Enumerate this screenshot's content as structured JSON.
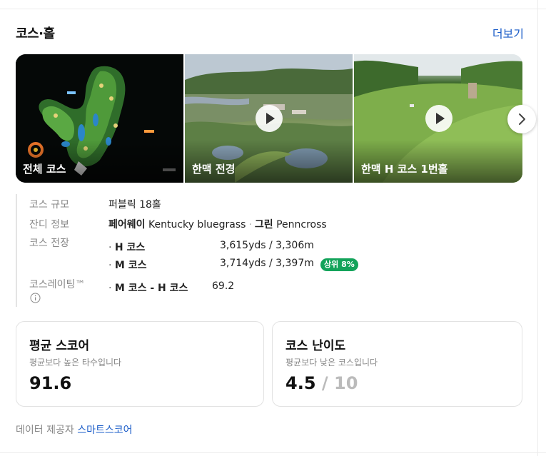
{
  "header": {
    "title": "코스·홀",
    "more_label": "더보기"
  },
  "gallery": [
    {
      "label": "전체 코스"
    },
    {
      "label": "한맥 전경"
    },
    {
      "label": "한맥 H 코스 1번홀"
    }
  ],
  "info": {
    "scale": {
      "label": "코스 규모",
      "value": "퍼블릭 18홀"
    },
    "turf": {
      "label": "잔디 정보",
      "fairway_name": "페어웨이",
      "fairway_value": "Kentucky bluegrass",
      "green_name": "그린",
      "green_value": "Penncross"
    },
    "length": {
      "label": "코스 전장",
      "rows": [
        {
          "name": "H 코스",
          "value": "3,615yds / 3,306m"
        },
        {
          "name": "M 코스",
          "value": "3,714yds / 3,397m",
          "badge": "상위 8%"
        }
      ]
    },
    "rating": {
      "label": "코스레이팅™",
      "name": "M 코스 - H 코스",
      "value": "69.2"
    }
  },
  "cards": {
    "avg_score": {
      "title": "평균 스코어",
      "subtitle": "평균보다 높은 타수입니다",
      "value": "91.6"
    },
    "difficulty": {
      "title": "코스 난이도",
      "subtitle": "평균보다 낮은 코스입니다",
      "value": "4.5",
      "max": "/ 10"
    }
  },
  "footer": {
    "prefix": "데이터 제공자",
    "provider": "스마트스코어"
  },
  "colors": {
    "accent": "#1a5cc8",
    "badge": "#13a35a"
  }
}
